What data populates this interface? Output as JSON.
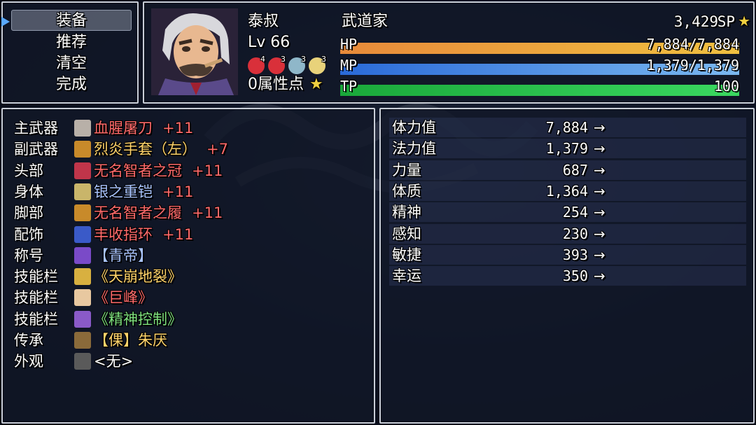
{
  "commands": [
    {
      "label": "装备",
      "selected": true
    },
    {
      "label": "推荐",
      "selected": false
    },
    {
      "label": "清空",
      "selected": false
    },
    {
      "label": "完成",
      "selected": false
    }
  ],
  "actor": {
    "name": "泰叔",
    "class": "武道家",
    "level_text": "Lv 66",
    "sp": "3,429",
    "sp_label": "SP",
    "attr_points": "0属性点",
    "states": [
      {
        "icon": "red-apple-icon",
        "num": "4",
        "color": "#d9303a"
      },
      {
        "icon": "red-apple-icon",
        "num": "3",
        "color": "#d9303a"
      },
      {
        "icon": "potion-icon",
        "num": "3",
        "color": "#8fb7c9"
      },
      {
        "icon": "flask-icon",
        "num": "3",
        "color": "#e8d27a"
      }
    ],
    "hp": {
      "label": "HP",
      "value": "7,884/7,884",
      "fraction": 1.0
    },
    "mp": {
      "label": "MP",
      "value": "1,379/1,379",
      "fraction": 1.0
    },
    "tp": {
      "label": "TP",
      "value": "100",
      "fraction": 1.0
    }
  },
  "equipment": [
    {
      "slot": "主武器",
      "name": "血腥屠刀",
      "plus": "+11",
      "name_color": "#ff6a6a",
      "icon": "blade-icon",
      "icon_color": "#b8b0a8"
    },
    {
      "slot": "副武器",
      "name": "烈炎手套（左）",
      "plus": "+7",
      "name_color": "#ffd36a",
      "icon": "glove-icon",
      "icon_color": "#c88a2a"
    },
    {
      "slot": "头部",
      "name": "无名智者之冠",
      "plus": "+11",
      "name_color": "#ff6a6a",
      "icon": "hat-icon",
      "icon_color": "#c0354a"
    },
    {
      "slot": "身体",
      "name": "银之重铠",
      "plus": "+11",
      "name_color": "#a9c4ff",
      "icon": "armor-icon",
      "icon_color": "#c9b56a"
    },
    {
      "slot": "脚部",
      "name": "无名智者之履",
      "plus": "+11",
      "name_color": "#ff6a6a",
      "icon": "boots-icon",
      "icon_color": "#c88a2a"
    },
    {
      "slot": "配饰",
      "name": "丰收指环",
      "plus": "+11",
      "name_color": "#ff6a6a",
      "icon": "ring-icon",
      "icon_color": "#3a5ac8"
    },
    {
      "slot": "称号",
      "name": "【青帝】",
      "plus": "",
      "name_color": "#a9c4ff",
      "icon": "star-badge-icon",
      "icon_color": "#7a4ac8"
    },
    {
      "slot": "技能栏",
      "name": "《天崩地裂》",
      "plus": "",
      "name_color": "#ffd36a",
      "icon": "quake-skill-icon",
      "icon_color": "#d8b040"
    },
    {
      "slot": "技能栏",
      "name": "《巨峰》",
      "plus": "",
      "name_color": "#ff6a6a",
      "icon": "peak-skill-icon",
      "icon_color": "#e8c8a0"
    },
    {
      "slot": "技能栏",
      "name": "《精神控制》",
      "plus": "",
      "name_color": "#7ee07e",
      "icon": "eye-skill-icon",
      "icon_color": "#8a5ac8"
    },
    {
      "slot": "传承",
      "name": "【倮】朱厌",
      "plus": "",
      "name_color": "#ffd36a",
      "icon": "gear-emblem-icon",
      "icon_color": "#8a6a3a"
    },
    {
      "slot": "外观",
      "name": "<无>",
      "plus": "",
      "name_color": "#ffffff",
      "icon": "empty-slot-icon",
      "icon_color": "#5a5a5a"
    }
  ],
  "params": [
    {
      "name": "体力值",
      "value": "7,884",
      "arrow": "→"
    },
    {
      "name": "法力值",
      "value": "1,379",
      "arrow": "→"
    },
    {
      "name": "力量",
      "value": "687",
      "arrow": "→"
    },
    {
      "name": "体质",
      "value": "1,364",
      "arrow": "→"
    },
    {
      "name": "精神",
      "value": "254",
      "arrow": "→"
    },
    {
      "name": "感知",
      "value": "230",
      "arrow": "→"
    },
    {
      "name": "敏捷",
      "value": "393",
      "arrow": "→"
    },
    {
      "name": "幸运",
      "value": "350",
      "arrow": "→"
    }
  ],
  "colors": {
    "hp_gauge": [
      "#e88a3a",
      "#f0c040"
    ],
    "mp_gauge": [
      "#2a6ad8",
      "#7ab8f0"
    ],
    "tp_gauge": [
      "#1aa83a",
      "#3ad860"
    ],
    "sp_star": "#f0d040"
  }
}
